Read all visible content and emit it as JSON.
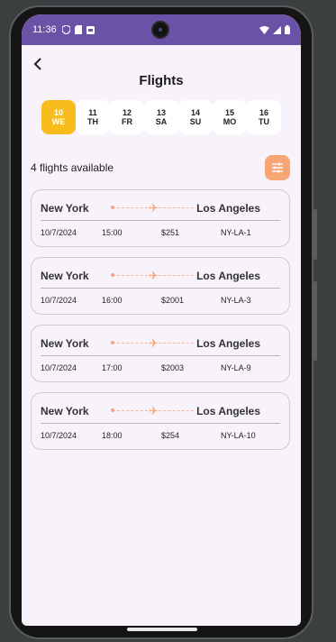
{
  "status": {
    "time": "11:36"
  },
  "header": {
    "back_label": "‹",
    "title": "Flights"
  },
  "days": [
    {
      "num": "10",
      "dow": "WE",
      "active": true
    },
    {
      "num": "11",
      "dow": "TH",
      "active": false
    },
    {
      "num": "12",
      "dow": "FR",
      "active": false
    },
    {
      "num": "13",
      "dow": "SA",
      "active": false
    },
    {
      "num": "14",
      "dow": "SU",
      "active": false
    },
    {
      "num": "15",
      "dow": "MO",
      "active": false
    },
    {
      "num": "16",
      "dow": "TU",
      "active": false
    }
  ],
  "summary": {
    "count_text": "4 flights available"
  },
  "flights": [
    {
      "from": "New York",
      "to": "Los Angeles",
      "date": "10/7/2024",
      "time": "15:00",
      "price": "$251",
      "code": "NY-LA-1"
    },
    {
      "from": "New York",
      "to": "Los Angeles",
      "date": "10/7/2024",
      "time": "16:00",
      "price": "$2001",
      "code": "NY-LA-3"
    },
    {
      "from": "New York",
      "to": "Los Angeles",
      "date": "10/7/2024",
      "time": "17:00",
      "price": "$2003",
      "code": "NY-LA-9"
    },
    {
      "from": "New York",
      "to": "Los Angeles",
      "date": "10/7/2024",
      "time": "18:00",
      "price": "$254",
      "code": "NY-LA-10"
    }
  ],
  "colors": {
    "header": "#6a52a6",
    "active_day": "#f8bd1c",
    "filter": "#f7a574",
    "plane": "#f6a779"
  },
  "icons": {
    "back": "arrow-left-icon",
    "filter": "sliders-icon",
    "plane": "airplane-icon"
  }
}
